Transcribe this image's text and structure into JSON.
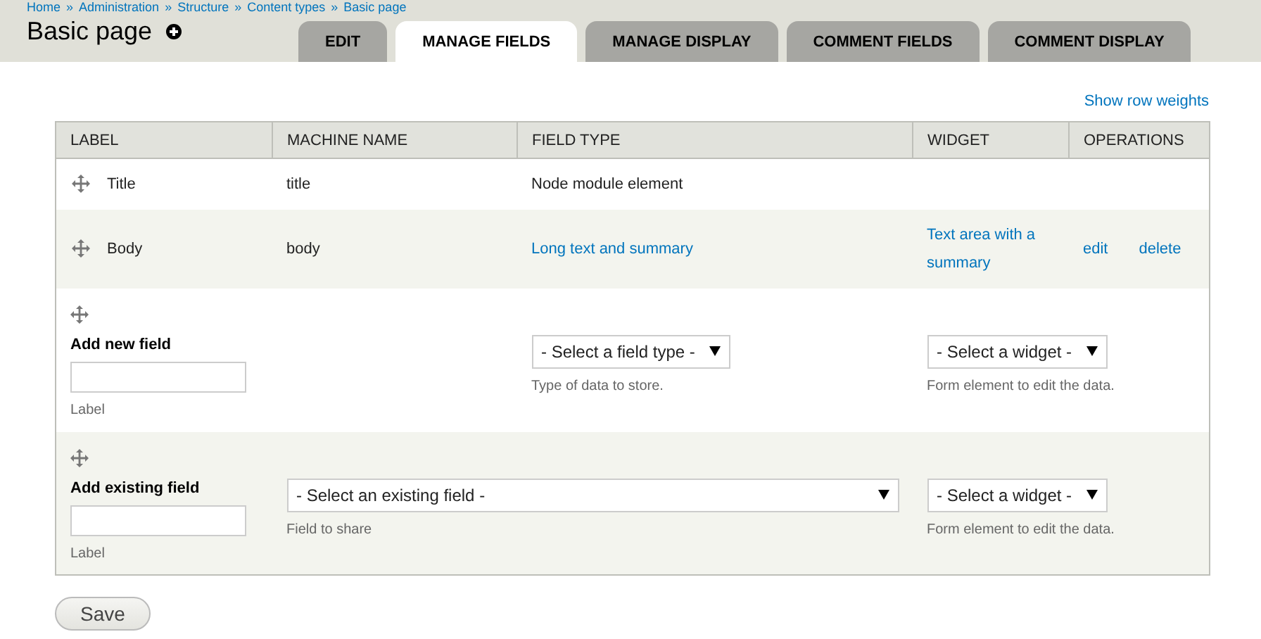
{
  "breadcrumb": [
    "Home",
    "»",
    "Administration",
    "»",
    "Structure",
    "»",
    "Content types",
    "»",
    "Basic page"
  ],
  "page_title": "Basic page",
  "tabs": [
    {
      "label": "EDIT",
      "selected": false
    },
    {
      "label": "MANAGE FIELDS",
      "selected": true
    },
    {
      "label": "MANAGE DISPLAY",
      "selected": false
    },
    {
      "label": "COMMENT FIELDS",
      "selected": false
    },
    {
      "label": "COMMENT DISPLAY",
      "selected": false
    }
  ],
  "show_row_weights": "Show row weights",
  "table": {
    "columns": [
      "LABEL",
      "MACHINE NAME",
      "FIELD TYPE",
      "WIDGET",
      "OPERATIONS"
    ],
    "rows": [
      {
        "kind": "field",
        "label": "Title",
        "machine_name": "title",
        "field_type": "Node module element",
        "field_type_link": false,
        "operations": []
      },
      {
        "kind": "field",
        "label": "Body",
        "machine_name": "body",
        "field_type": "Long text and summary",
        "field_type_link": true,
        "widget": "Text area with a summary",
        "operations": [
          "edit",
          "delete"
        ]
      },
      {
        "kind": "new_field",
        "title": "Add new field",
        "input_description": "Label",
        "type_select": {
          "value": "- Select a field type -",
          "description": "Type of data to store."
        },
        "widget_select": {
          "value": "- Select a widget -",
          "description": "Form element to edit the data."
        }
      },
      {
        "kind": "existing_field",
        "title": "Add existing field",
        "input_description": "Label",
        "field_select": {
          "value": "- Select an existing field -",
          "description": "Field to share"
        },
        "widget_select": {
          "value": "- Select a widget -",
          "description": "Form element to edit the data."
        }
      }
    ]
  },
  "save_button": "Save"
}
